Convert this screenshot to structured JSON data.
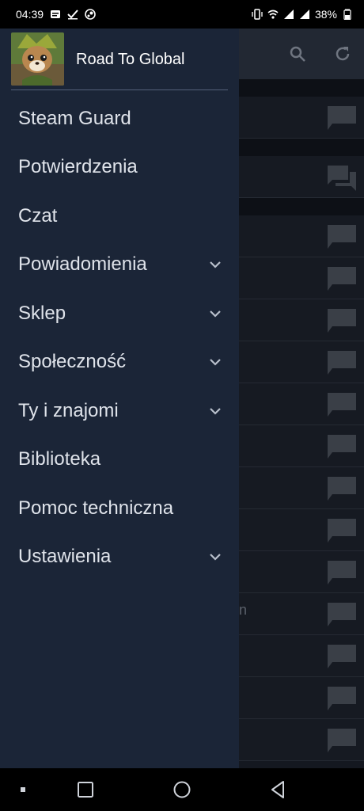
{
  "status_bar": {
    "time": "04:39",
    "battery": "38%",
    "icons_left": [
      "notification-card-icon",
      "check-icon",
      "steam-icon"
    ],
    "icons_right": [
      "vibrate-icon",
      "wifi-icon",
      "signal-1-icon",
      "signal-2-icon",
      "battery-icon"
    ]
  },
  "profile": {
    "name": "Road To Global",
    "avatar": "fox-character-avatar"
  },
  "menu": {
    "items": [
      {
        "label": "Steam Guard",
        "expandable": false
      },
      {
        "label": "Potwierdzenia",
        "expandable": false
      },
      {
        "label": "Czat",
        "expandable": false
      },
      {
        "label": "Powiadomienia",
        "expandable": true
      },
      {
        "label": "Sklep",
        "expandable": true
      },
      {
        "label": "Społeczność",
        "expandable": true
      },
      {
        "label": "Ty i znajomi",
        "expandable": true
      },
      {
        "label": "Biblioteka",
        "expandable": false
      },
      {
        "label": "Pomoc techniczna",
        "expandable": false
      },
      {
        "label": "Ustawienia",
        "expandable": true
      }
    ]
  },
  "background": {
    "header_icons": [
      "search-icon",
      "refresh-icon"
    ],
    "partial_text": "n"
  },
  "nav_bar": {
    "buttons": [
      "dot-button",
      "recents-button",
      "home-button",
      "back-button"
    ]
  },
  "colors": {
    "drawer_bg": "#1b2537",
    "menu_text": "#dfe3ea",
    "divider": "#55607a",
    "overlay_bg": "#141820"
  }
}
